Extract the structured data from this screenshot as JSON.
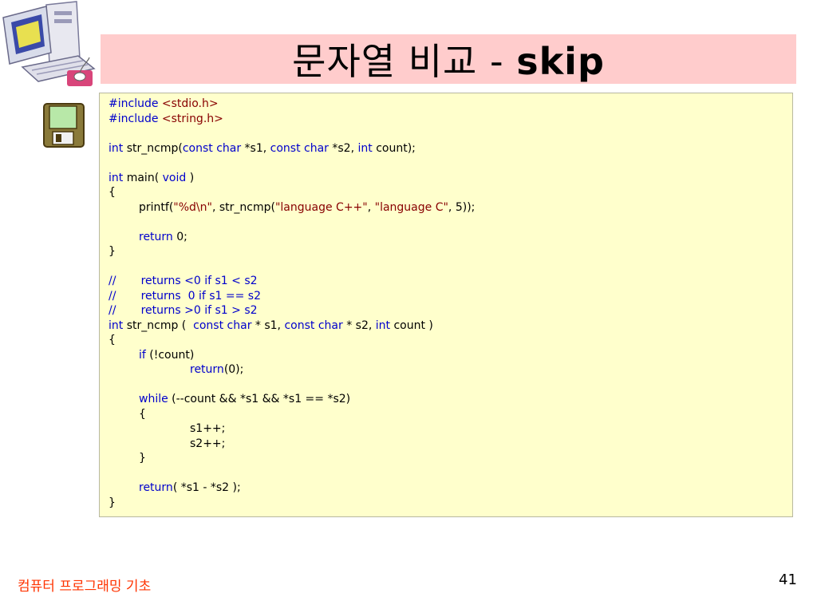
{
  "slide": {
    "title_korean": "문자열 비교",
    "title_separator": " - ",
    "title_bold": "skip",
    "footer": "컴퓨터 프로그래밍 기초",
    "page_number": "41"
  },
  "icons": {
    "top_left": "computer-icon",
    "side": "floppy-disk-icon"
  },
  "colors": {
    "title_background": "#ffcccc",
    "code_background": "#ffffcc",
    "keyword": "#0000cc",
    "string": "#880000",
    "footer": "#ff3300"
  },
  "code": {
    "l1_pp": "#include",
    "l1_rest": " <stdio.h>",
    "l2_pp": "#include",
    "l2_rest": " <string.h>",
    "l4_a": "int",
    "l4_b": " str_ncmp(",
    "l4_c": "const",
    "l4_d": " ",
    "l4_e": "char",
    "l4_f": " *s1, ",
    "l4_g": "const",
    "l4_h": " ",
    "l4_i": "char",
    "l4_j": " *s2, ",
    "l4_k": "int",
    "l4_l": " count);",
    "l6_a": "int",
    "l6_b": " main( ",
    "l6_c": "void",
    "l6_d": " )",
    "l7": "{",
    "l8_a": "printf(",
    "l8_b": "\"%d\\n\"",
    "l8_c": ", str_ncmp(",
    "l8_d": "\"language C++\"",
    "l8_e": ", ",
    "l8_f": "\"language C\"",
    "l8_g": ", 5));",
    "l10_a": "return",
    "l10_b": " 0;",
    "l11": "}",
    "l13": "//       returns <0 if s1 < s2",
    "l14": "//       returns  0 if s1 == s2",
    "l15": "//       returns >0 if s1 > s2",
    "l16_a": "int",
    "l16_b": " str_ncmp (  ",
    "l16_c": "const",
    "l16_d": " ",
    "l16_e": "char",
    "l16_f": " * s1, ",
    "l16_g": "const",
    "l16_h": " ",
    "l16_i": "char",
    "l16_j": " * s2, ",
    "l16_k": "int",
    "l16_l": " count )",
    "l17": "{",
    "l18_a": "if",
    "l18_b": " (!count)",
    "l19_a": "return",
    "l19_b": "(0);",
    "l21_a": "while",
    "l21_b": " (--count && *s1 && *s1 == *s2)",
    "l22": "{",
    "l23": "s1++;",
    "l24": "s2++;",
    "l25": "}",
    "l27_a": "return",
    "l27_b": "( *s1 - *s2 );",
    "l28": "}"
  }
}
